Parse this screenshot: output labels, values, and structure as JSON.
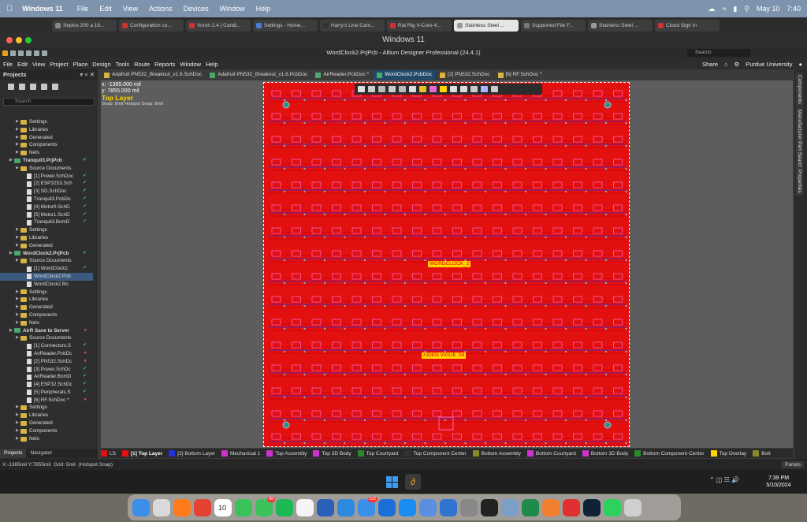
{
  "menubar": {
    "app": "Windows 11",
    "items": [
      "File",
      "Edit",
      "View",
      "Actions",
      "Devices",
      "Window",
      "Help"
    ],
    "date": "May 10",
    "time": "7:40"
  },
  "browser_tabs": [
    {
      "label": "Seplos 200 a 16...",
      "color": "#888"
    },
    {
      "label": "Configuration co...",
      "color": "#c33"
    },
    {
      "label": "Voron 2.4 | Candi...",
      "color": "#c33"
    },
    {
      "label": "Settings - Home...",
      "color": "#4a7ad9"
    },
    {
      "label": "Harry's Line Cam...",
      "color": "#333"
    },
    {
      "label": "Rat Rig V-Core 4...",
      "color": "#c33"
    },
    {
      "label": "Stainless Steel ...",
      "color": "#999",
      "active": true
    },
    {
      "label": "Supported File F...",
      "color": "#777"
    },
    {
      "label": "Stainless Steel ...",
      "color": "#999"
    },
    {
      "label": "Cloud Sign In",
      "color": "#c33"
    }
  ],
  "window_title": "Windows 11",
  "altium": {
    "title": "WordClock2.PrjPcb - Altium Designer Professional (24.4.1)",
    "search_placeholder": "Search",
    "menu": [
      "File",
      "Edit",
      "View",
      "Project",
      "Place",
      "Design",
      "Tools",
      "Route",
      "Reports",
      "Window",
      "Help"
    ],
    "share": "Share",
    "user": "Purdue University"
  },
  "projects_panel": {
    "title": "Projects",
    "search_placeholder": "Search",
    "tree": [
      {
        "label": "Settings",
        "type": "folder",
        "indent": 2
      },
      {
        "label": "Libraries",
        "type": "folder",
        "indent": 2
      },
      {
        "label": "Generated",
        "type": "folder",
        "indent": 2
      },
      {
        "label": "Components",
        "type": "folder",
        "indent": 2
      },
      {
        "label": "Nets",
        "type": "folder",
        "indent": 2
      },
      {
        "label": "Tranquil3.PrjPcb",
        "type": "project",
        "indent": 1,
        "status": "ok",
        "bold": true
      },
      {
        "label": "Source Documents",
        "type": "folder",
        "indent": 2
      },
      {
        "label": "[1] Power.SchDoc",
        "type": "doc",
        "indent": 3,
        "status": "ok"
      },
      {
        "label": "[2] ESP32S3.Sch",
        "type": "doc",
        "indent": 3,
        "status": "ok"
      },
      {
        "label": "[3] SD.SchDoc",
        "type": "doc",
        "indent": 3,
        "status": "ok"
      },
      {
        "label": "Tranquil3.PcbDo",
        "type": "doc",
        "indent": 3,
        "status": "ok"
      },
      {
        "label": "[4] Motor0.SchD",
        "type": "doc",
        "indent": 3,
        "status": "ok"
      },
      {
        "label": "[5] Motor1.SchD",
        "type": "doc",
        "indent": 3,
        "status": "ok"
      },
      {
        "label": "Tranquil3.BomD",
        "type": "doc",
        "indent": 3,
        "status": "ok"
      },
      {
        "label": "Settings",
        "type": "folder",
        "indent": 2
      },
      {
        "label": "Libraries",
        "type": "folder",
        "indent": 2
      },
      {
        "label": "Generated",
        "type": "folder",
        "indent": 2
      },
      {
        "label": "WordClock2.PrjPcb",
        "type": "project",
        "indent": 1,
        "status": "ok",
        "bold": true
      },
      {
        "label": "Source Documents",
        "type": "folder",
        "indent": 2
      },
      {
        "label": "[1] WordClock2.",
        "type": "doc",
        "indent": 3,
        "status": "ok"
      },
      {
        "label": "WordClock2.Pcb",
        "type": "doc",
        "indent": 3,
        "status": "",
        "selected": true
      },
      {
        "label": "WordClock2.Bo",
        "type": "doc",
        "indent": 3,
        "status": ""
      },
      {
        "label": "Settings",
        "type": "folder",
        "indent": 2
      },
      {
        "label": "Libraries",
        "type": "folder",
        "indent": 2
      },
      {
        "label": "Generated",
        "type": "folder",
        "indent": 2
      },
      {
        "label": "Components",
        "type": "folder",
        "indent": 2
      },
      {
        "label": "Nets",
        "type": "folder",
        "indent": 2
      },
      {
        "label": "AirR  Save to Server",
        "type": "project",
        "indent": 1,
        "status": "bad",
        "bold": true
      },
      {
        "label": "Source Documents",
        "type": "folder",
        "indent": 2
      },
      {
        "label": "[1] Connectors.S",
        "type": "doc",
        "indent": 3,
        "status": "ok"
      },
      {
        "label": "AirReader.PcbDc",
        "type": "doc",
        "indent": 3,
        "status": "bad"
      },
      {
        "label": "[2] PN532.SchDc",
        "type": "doc",
        "indent": 3,
        "status": "bad"
      },
      {
        "label": "[3] Power.SchDc",
        "type": "doc",
        "indent": 3,
        "status": "ok"
      },
      {
        "label": "AirReader.BomD",
        "type": "doc",
        "indent": 3,
        "status": "ok"
      },
      {
        "label": "[4] ESP32.SchDc",
        "type": "doc",
        "indent": 3,
        "status": "ok"
      },
      {
        "label": "[5] Peripherals.S",
        "type": "doc",
        "indent": 3,
        "status": "ok"
      },
      {
        "label": "[6] RF.SchDoc *",
        "type": "doc",
        "indent": 3,
        "status": "bad"
      },
      {
        "label": "Settings",
        "type": "folder",
        "indent": 2
      },
      {
        "label": "Libraries",
        "type": "folder",
        "indent": 2
      },
      {
        "label": "Generated",
        "type": "folder",
        "indent": 2
      },
      {
        "label": "Components",
        "type": "folder",
        "indent": 2
      },
      {
        "label": "Nets",
        "type": "folder",
        "indent": 2
      }
    ],
    "bottom_tabs": [
      "Projects",
      "Navigator"
    ]
  },
  "doc_tabs": [
    {
      "label": "Adafruit PN532_Breakout_v1.6.SchDoc",
      "kind": "sch"
    },
    {
      "label": "Adafruit PN532_Breakout_v1.6.PcbDoc",
      "kind": "pcb"
    },
    {
      "label": "AirReader.PcbDoc *",
      "kind": "pcb"
    },
    {
      "label": "WordClock2.PcbDoc",
      "kind": "pcb",
      "active": true
    },
    {
      "label": "[2] PN532.SchDoc",
      "kind": "sch"
    },
    {
      "label": "[6] RF.SchDoc *",
      "kind": "sch"
    }
  ],
  "hud": {
    "x": "x: -1385.000 mil",
    "y": "y: 7855.000 mil",
    "layer": "Top Layer",
    "snap": "Snap: 5mil Hotspot Snap: 8mil"
  },
  "board": {
    "label1": "WORDCLOCK_2",
    "label2": "AIDEN VIGUE '24"
  },
  "right_panels": [
    "Components",
    "Manufacturer Part Search",
    "Properties"
  ],
  "layers": [
    {
      "label": "LS",
      "color": "#e31010"
    },
    {
      "label": "[1] Top Layer",
      "color": "#e31010",
      "active": true
    },
    {
      "label": "[2] Bottom Layer",
      "color": "#2233dd"
    },
    {
      "label": "Mechanical 1",
      "color": "#cc33cc"
    },
    {
      "label": "Top Assembly",
      "color": "#cc33cc"
    },
    {
      "label": "Top 3D Body",
      "color": "#cc33cc"
    },
    {
      "label": "Top Courtyard",
      "color": "#2a8a2a"
    },
    {
      "label": "Top Component Center",
      "color": "#333333"
    },
    {
      "label": "Bottom Assembly",
      "color": "#8a8a2a"
    },
    {
      "label": "Bottom Courtyard",
      "color": "#cc33cc"
    },
    {
      "label": "Bottom 3D Body",
      "color": "#cc33cc"
    },
    {
      "label": "Bottom Component Center",
      "color": "#2a8a2a"
    },
    {
      "label": "Top Overlay",
      "color": "#ffd400"
    },
    {
      "label": "Bott",
      "color": "#8a8a2a"
    }
  ],
  "status": {
    "coords": "X:-1385mil Y:7855mil",
    "grid": "Grid: 5mil",
    "snap": "(Hotspot Snap)",
    "panels": "Panels"
  },
  "taskbar": {
    "time": "7:39 PM",
    "date": "5/10/2024"
  },
  "dock": [
    {
      "name": "finder",
      "color": "#3b8fe8"
    },
    {
      "name": "launchpad",
      "color": "#d9d9d9"
    },
    {
      "name": "firefox",
      "color": "#ff7a1a"
    },
    {
      "name": "todoist",
      "color": "#e44332"
    },
    {
      "name": "calendar",
      "color": "#ffffff",
      "text": "10"
    },
    {
      "name": "facetime",
      "color": "#3ac35a"
    },
    {
      "name": "messages",
      "color": "#3ac35a",
      "badge": "88"
    },
    {
      "name": "spotify",
      "color": "#1db954"
    },
    {
      "name": "photos",
      "color": "#f4f4f4"
    },
    {
      "name": "word",
      "color": "#2b5fb8"
    },
    {
      "name": "vscode",
      "color": "#2d8ae0"
    },
    {
      "name": "mail",
      "color": "#3b8fe8",
      "badge": "222"
    },
    {
      "name": "1password",
      "color": "#1c6fd6"
    },
    {
      "name": "appstore",
      "color": "#1b8cf2"
    },
    {
      "name": "pencil",
      "color": "#5a8fe0"
    },
    {
      "name": "xcode",
      "color": "#2f74d0"
    },
    {
      "name": "settings",
      "color": "#888888"
    },
    {
      "name": "terminal",
      "color": "#222222"
    },
    {
      "name": "preview",
      "color": "#7aa0c8"
    },
    {
      "name": "excel",
      "color": "#1f8a4c"
    },
    {
      "name": "fusion",
      "color": "#f08030"
    },
    {
      "name": "parallels",
      "color": "#e03030"
    },
    {
      "name": "photoshop",
      "color": "#0f2236"
    },
    {
      "name": "whatsapp",
      "color": "#2ed15e"
    },
    {
      "name": "trash",
      "color": "#cfcfcf"
    }
  ]
}
